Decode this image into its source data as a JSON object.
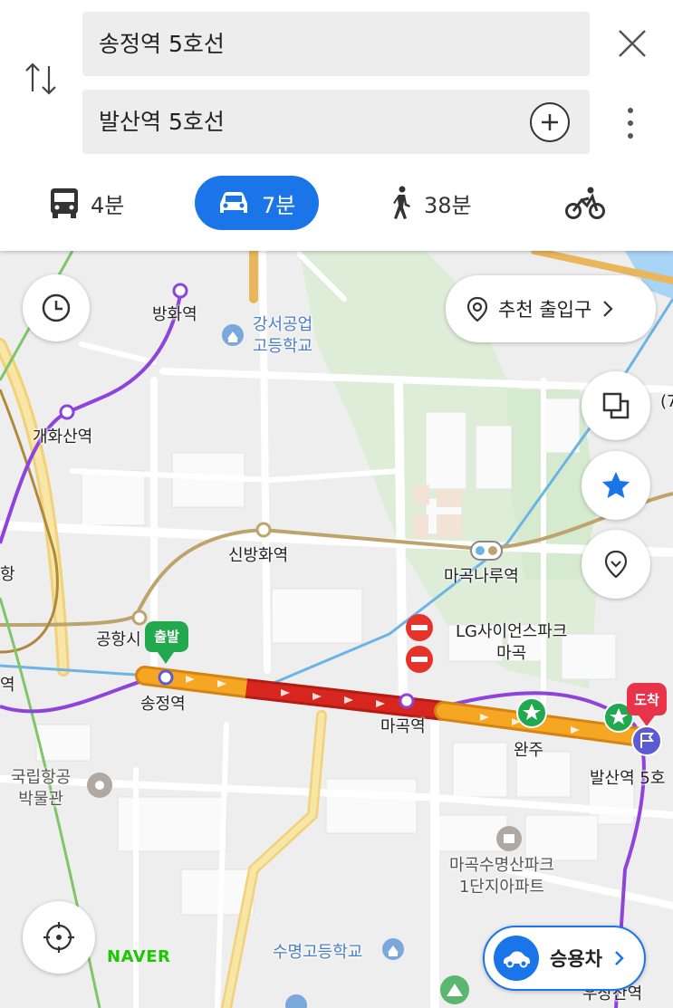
{
  "route": {
    "origin": "송정역 5호선",
    "destination": "발산역 5호선"
  },
  "modes": [
    {
      "name": "transit",
      "time": "4분",
      "icon": "bus-icon",
      "active": false
    },
    {
      "name": "car",
      "time": "7분",
      "icon": "car-icon",
      "active": true
    },
    {
      "name": "walk",
      "time": "38분",
      "icon": "walk-icon",
      "active": false
    },
    {
      "name": "bike",
      "time": "",
      "icon": "bike-icon",
      "active": false
    }
  ],
  "map": {
    "recommended_exit": "추천 출입구",
    "start_marker": "출발",
    "end_marker": "도착",
    "brand": "NAVER",
    "vehicle_button": "승용차",
    "labels": {
      "banghwa": "방화역",
      "gangseo_school": "강서공업\n고등학교",
      "gaehwasan": "개화산역",
      "sinbanghwa": "신방화역",
      "magoknaru": "마곡나루역",
      "lg_science": "LG사이언스파크\n마곡",
      "airport": "공항시",
      "songjeong": "송정역",
      "magok": "마곡역",
      "wanju": "완주",
      "balsan": "발산역 5호",
      "aviation_museum": "국립항공\n박물관",
      "magok_apt": "마곡수명산파크\n1단지아파트",
      "sumyeong_school": "수명고등학교",
      "woojang": "우장산역",
      "edge_left_1": "항",
      "edge_left_2": "역",
      "edge_right": "(7"
    },
    "colors": {
      "route_orange": "#f5a623",
      "route_red": "#d7261e",
      "line5": "#8e44dc",
      "line9": "#bda36c",
      "airport_line": "#6cb3e6",
      "start_green": "#22a84f",
      "end_red": "#e8344a",
      "accent_blue": "#1a76e8"
    }
  }
}
